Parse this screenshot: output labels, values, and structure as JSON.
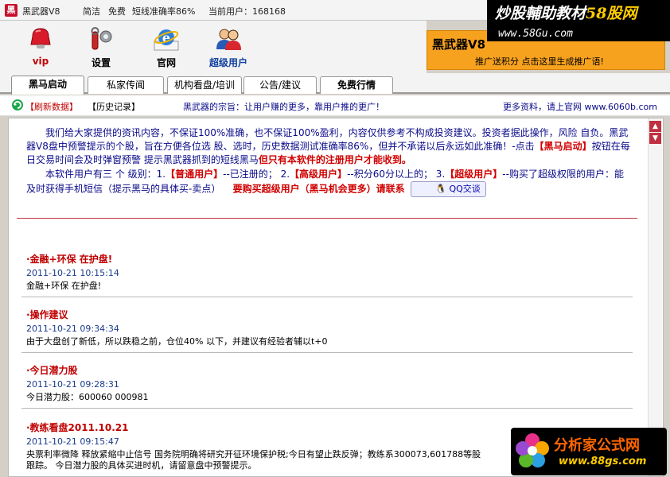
{
  "titlebar": {
    "app_name": "黑武器V8",
    "t1": "简洁",
    "t2": "免费",
    "t3": "短线准确率86%",
    "t4": "当前用户：168168"
  },
  "watermark_top": {
    "text": "炒股輔助教材",
    "brand": "58股网",
    "url": "www.58Gu.com"
  },
  "banner": {
    "title": "黑武器V8",
    "sub": "推广送积分  点击这里生成推广语!"
  },
  "toolbar": {
    "vip": "vip",
    "settings": "设置",
    "website": "官网",
    "super_user": "超级用户"
  },
  "tabs": [
    "黑马启动",
    "私家传闻",
    "机构看盘/培训",
    "公告/建议",
    "免费行情"
  ],
  "infobar": {
    "refresh": "【刷新数据】",
    "history": "【历史记录】",
    "motto": "黑武器的宗旨：让用户赚的更多，靠用户推的更广！",
    "more": "更多资料，请上官网 www.6060b.com"
  },
  "intro": {
    "p1a": "我们给大家提供的资讯内容，不保证100%准确，也不保证100%盈利，内容仅供参考不构成投资建议。投资者据此操作，风险 自负。黑武器V8盘中预警提示的个股，旨在方便各位选  股、选时，历史数据测试准确率86%，但并不承诺以后永远如此准确！-点击",
    "p1b": "【黑马启动】",
    "p1c": "按钮在每日交易时间会及时弹窗预警  提示黑武器抓到的短线黑马",
    "p1d": "但只有本软件的注册用户才能收到。",
    "p2a": "本软件用户有三 个 级别：1.",
    "p2b": "【普通用户】",
    "p2c": "--已注册的；  2.",
    "p2d": "【高级用户】",
    "p2e": "--积分60分以上的；   3.",
    "p2f": "【超级用户】",
    "p2g": "--购买了超级权限的用户：能及时获得手机短信（提示黑马的具体买-卖点）",
    "p2h": "要购买超级用户（黑马机会更多）请联系",
    "qq": "QQ交谈"
  },
  "news": [
    {
      "title": "·金融+环保  在护盘!",
      "date": "2011-10-21  10:15:14",
      "body": "金融+环保  在护盘!"
    },
    {
      "title": "·操作建议",
      "date": "2011-10-21  09:34:34",
      "body": "由于大盘创了新低，所以跌稳之前，仓位40% 以下，并建议有经验者辅以t+0"
    },
    {
      "title": "·今日潜力股",
      "date": "2011-10-21  09:28:31",
      "body": "今日潜力股：600060 000981"
    },
    {
      "title": "·教练看盘2011.10.21",
      "date": "2011-10-21  09:15:47",
      "body": "央票利率微降  释放紧缩中止信号 国务院明确将研究开征环境保护税;今日有望止跌反弹；教练系300073,601788等股",
      "body2": "跟踪。  今日潜力股的具体买进时机，请留意盘中预警提示。"
    }
  ],
  "watermark_bottom": {
    "name": "分析家公式网",
    "url": "www.88gs.com"
  }
}
